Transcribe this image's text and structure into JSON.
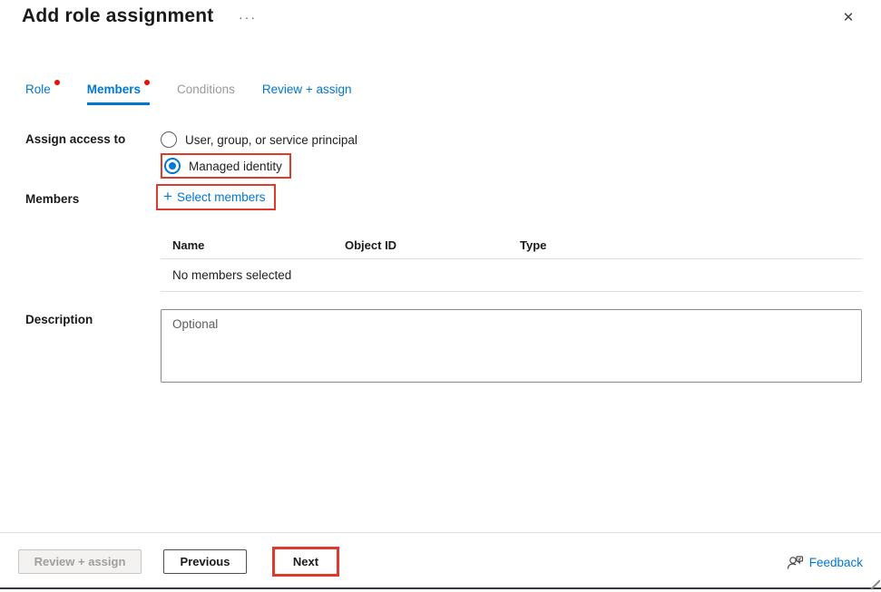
{
  "panel": {
    "title": "Add role assignment",
    "more_options_glyph": "···",
    "close_glyph": "✕"
  },
  "tabs": [
    {
      "label": "Role",
      "has_alert_dot": true,
      "active": false
    },
    {
      "label": "Members",
      "has_alert_dot": true,
      "active": true
    },
    {
      "label": "Conditions",
      "has_alert_dot": false,
      "active": false,
      "disabled": true
    },
    {
      "label": "Review + assign",
      "has_alert_dot": false,
      "active": false
    }
  ],
  "form": {
    "assign_access_to": {
      "label": "Assign access to",
      "option_user": "User, group, or service principal",
      "option_managed": "Managed identity",
      "selected_option": "Managed identity"
    },
    "members": {
      "label": "Members",
      "select_plus_glyph": "+",
      "select_label": "Select members",
      "columns": [
        "Name",
        "Object ID",
        "Type"
      ],
      "empty_text": "No members selected"
    },
    "description": {
      "label": "Description",
      "placeholder": "Optional",
      "value": ""
    }
  },
  "footer": {
    "review_assign": "Review + assign",
    "previous": "Previous",
    "next": "Next",
    "feedback": "Feedback"
  },
  "colors": {
    "accent_blue": "#0078d4",
    "highlight_red": "#de3b2c",
    "alert_dot_red": "#eb1000",
    "disabled_text": "#a19f9d"
  }
}
